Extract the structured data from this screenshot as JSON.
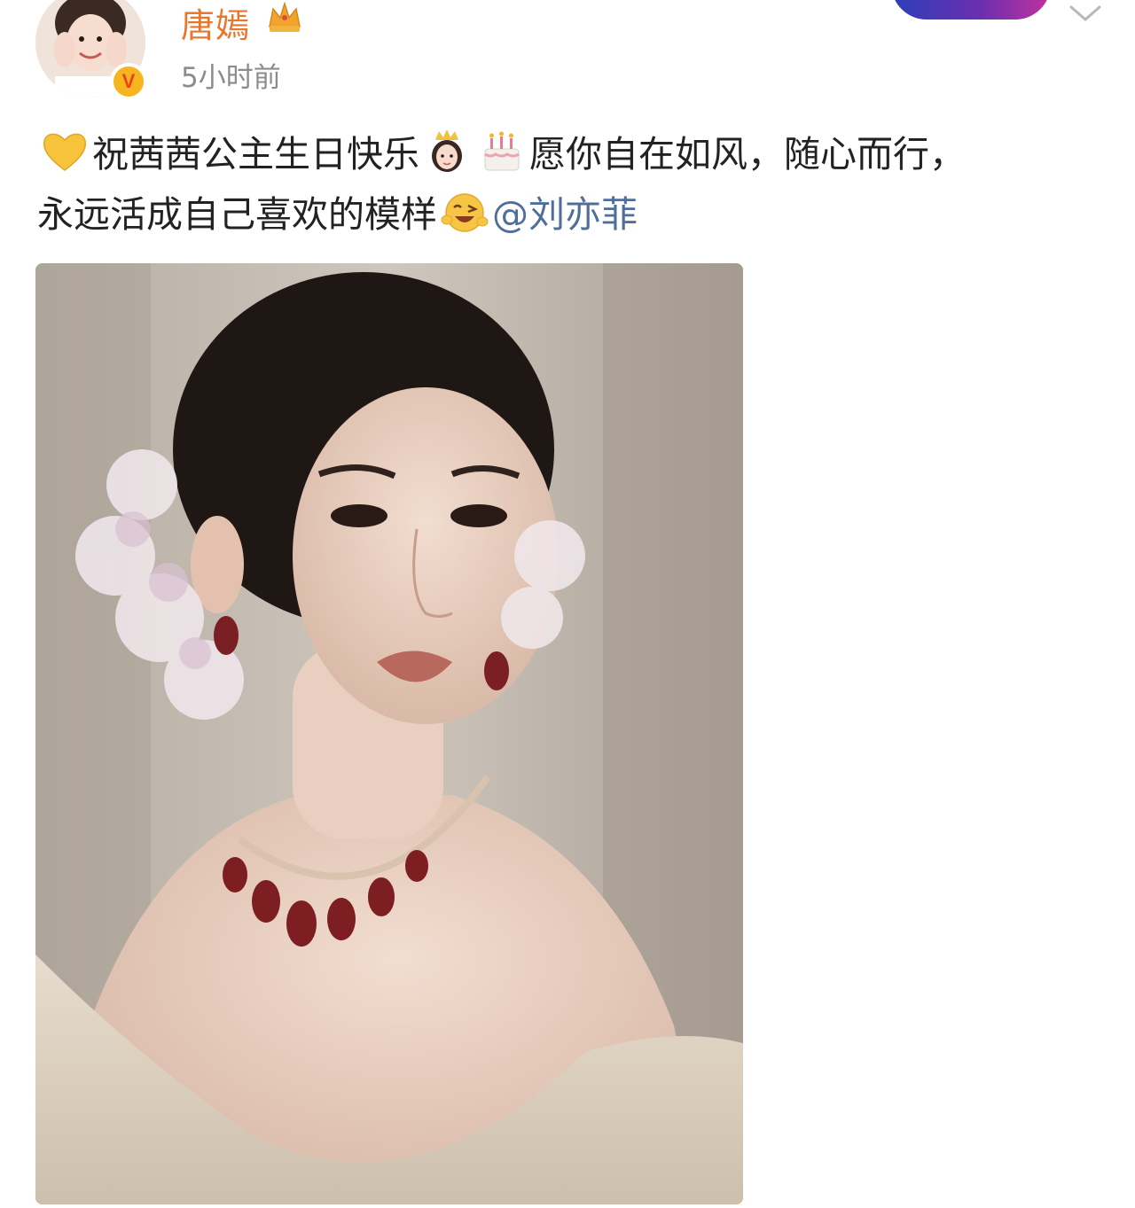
{
  "author": {
    "name": "唐嫣",
    "time": "5小时前",
    "verified_mark": "V"
  },
  "post": {
    "line1_a": "祝茜茜公主生日快乐",
    "line1_b": "愿你自在如风，随心而行，",
    "line2_a": "永远活成自己喜欢的模样",
    "mention": "@刘亦菲"
  },
  "icons": {
    "heart": "yellow-heart-icon",
    "princess": "princess-emoji-icon",
    "cake": "birthday-cake-emoji-icon",
    "wink": "winking-face-emoji-icon",
    "crown": "crown-badge-icon",
    "more": "chevron-down-icon"
  },
  "colors": {
    "username": "#e8772e",
    "mention": "#4f6f9a",
    "timestamp": "#8c8c8c",
    "verified": "#f6b51e"
  }
}
